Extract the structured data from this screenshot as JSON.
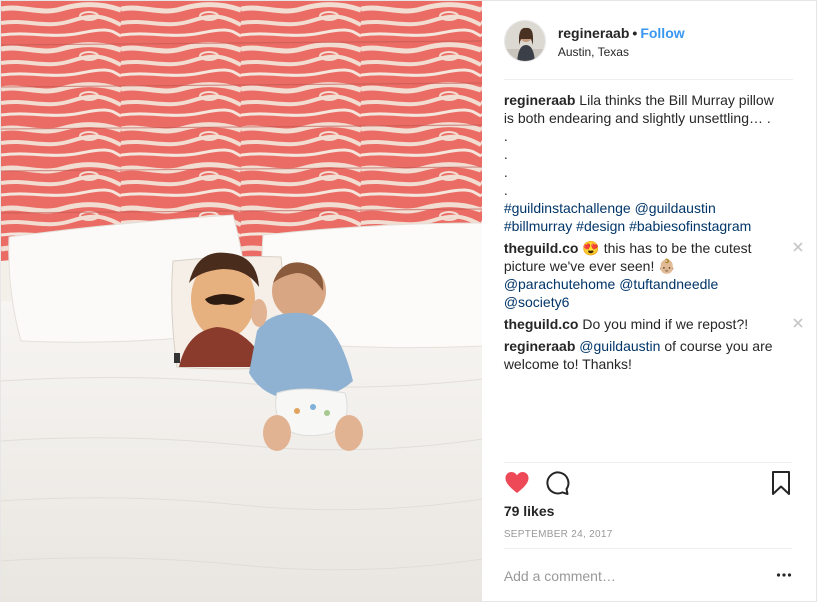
{
  "header": {
    "username": "regineraab",
    "dot": "•",
    "follow_label": "Follow",
    "location": "Austin, Texas"
  },
  "caption": {
    "username": "regineraab",
    "text": "Lila thinks the Bill Murray pillow is both endearing and slightly unsettling… .",
    "dots": [
      ".",
      ".",
      ".",
      "."
    ],
    "tags": [
      "#guildinstachallenge",
      "@guildaustin",
      "#billmurray",
      "#design",
      "#babiesofinstagram"
    ]
  },
  "comments": [
    {
      "username": "theguild.co",
      "emoji": "😍",
      "text": "this has to be the cutest picture we've ever seen!",
      "emoji2": "👶🏼",
      "mentions": [
        "@parachutehome",
        "@tuftandneedle",
        "@society6"
      ]
    },
    {
      "username": "theguild.co",
      "text": "Do you mind if we repost?!"
    },
    {
      "username": "regineraab",
      "mention": "@guildaustin",
      "text": "of course you are welcome to! Thanks!"
    }
  ],
  "likes": "79 likes",
  "date": "SEPTEMBER 24, 2017",
  "add_comment": {
    "placeholder": "Add a comment…"
  },
  "icons": {
    "like": "heart-icon",
    "comment": "comment-bubble-icon",
    "save": "bookmark-icon",
    "delete": "close-icon",
    "more": "more-options-icon"
  },
  "colors": {
    "accent": "#3897f0",
    "like": "#ed4956",
    "link": "#003569",
    "wall_red": "#e8574f"
  }
}
